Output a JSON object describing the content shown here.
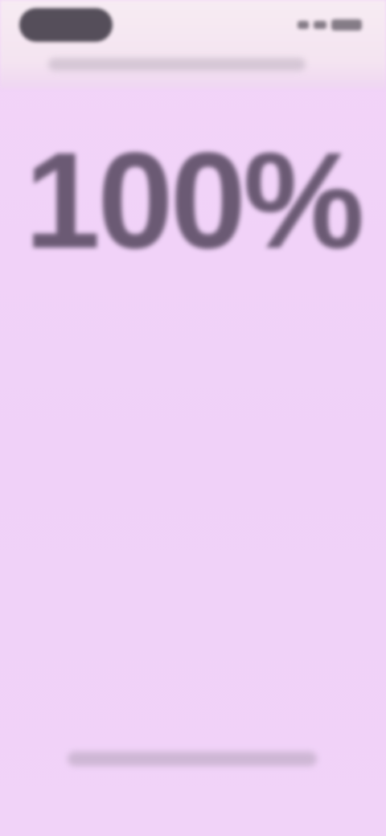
{
  "display": {
    "percentage": "100%"
  },
  "colors": {
    "background": "#f1d2f7",
    "text": "#6b5a74"
  }
}
